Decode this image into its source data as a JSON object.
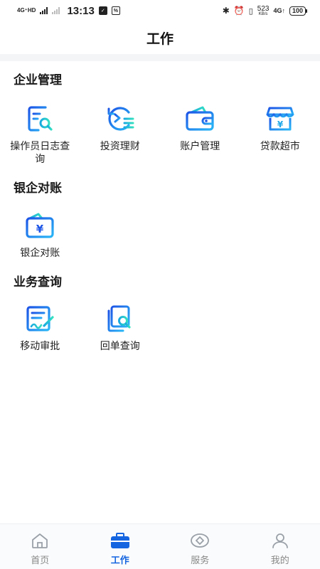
{
  "status_bar": {
    "network_type": "4G⁺HD",
    "time": "13:13",
    "net_speed": "523",
    "net_speed_unit": "KB/s",
    "network_type_2": "4G↑",
    "battery": "100"
  },
  "header": {
    "title": "工作"
  },
  "sections": [
    {
      "title": "企业管理",
      "items": [
        {
          "label": "操作员日志查询",
          "icon": "operator-log-icon"
        },
        {
          "label": "投资理财",
          "icon": "investment-icon"
        },
        {
          "label": "账户管理",
          "icon": "wallet-icon"
        },
        {
          "label": "贷款超市",
          "icon": "loan-market-icon"
        }
      ]
    },
    {
      "title": "银企对账",
      "items": [
        {
          "label": "银企对账",
          "icon": "reconciliation-icon"
        }
      ]
    },
    {
      "title": "业务查询",
      "items": [
        {
          "label": "移动审批",
          "icon": "approval-icon"
        },
        {
          "label": "回单查询",
          "icon": "receipt-query-icon"
        }
      ]
    }
  ],
  "tab_bar": {
    "tabs": [
      {
        "label": "首页",
        "icon": "home-icon",
        "active": false
      },
      {
        "label": "工作",
        "icon": "briefcase-icon",
        "active": true
      },
      {
        "label": "服务",
        "icon": "service-icon",
        "active": false
      },
      {
        "label": "我的",
        "icon": "profile-icon",
        "active": false
      }
    ]
  },
  "colors": {
    "accent": "#1565e0",
    "accent_light": "#29b6f6",
    "inactive": "#888888"
  }
}
